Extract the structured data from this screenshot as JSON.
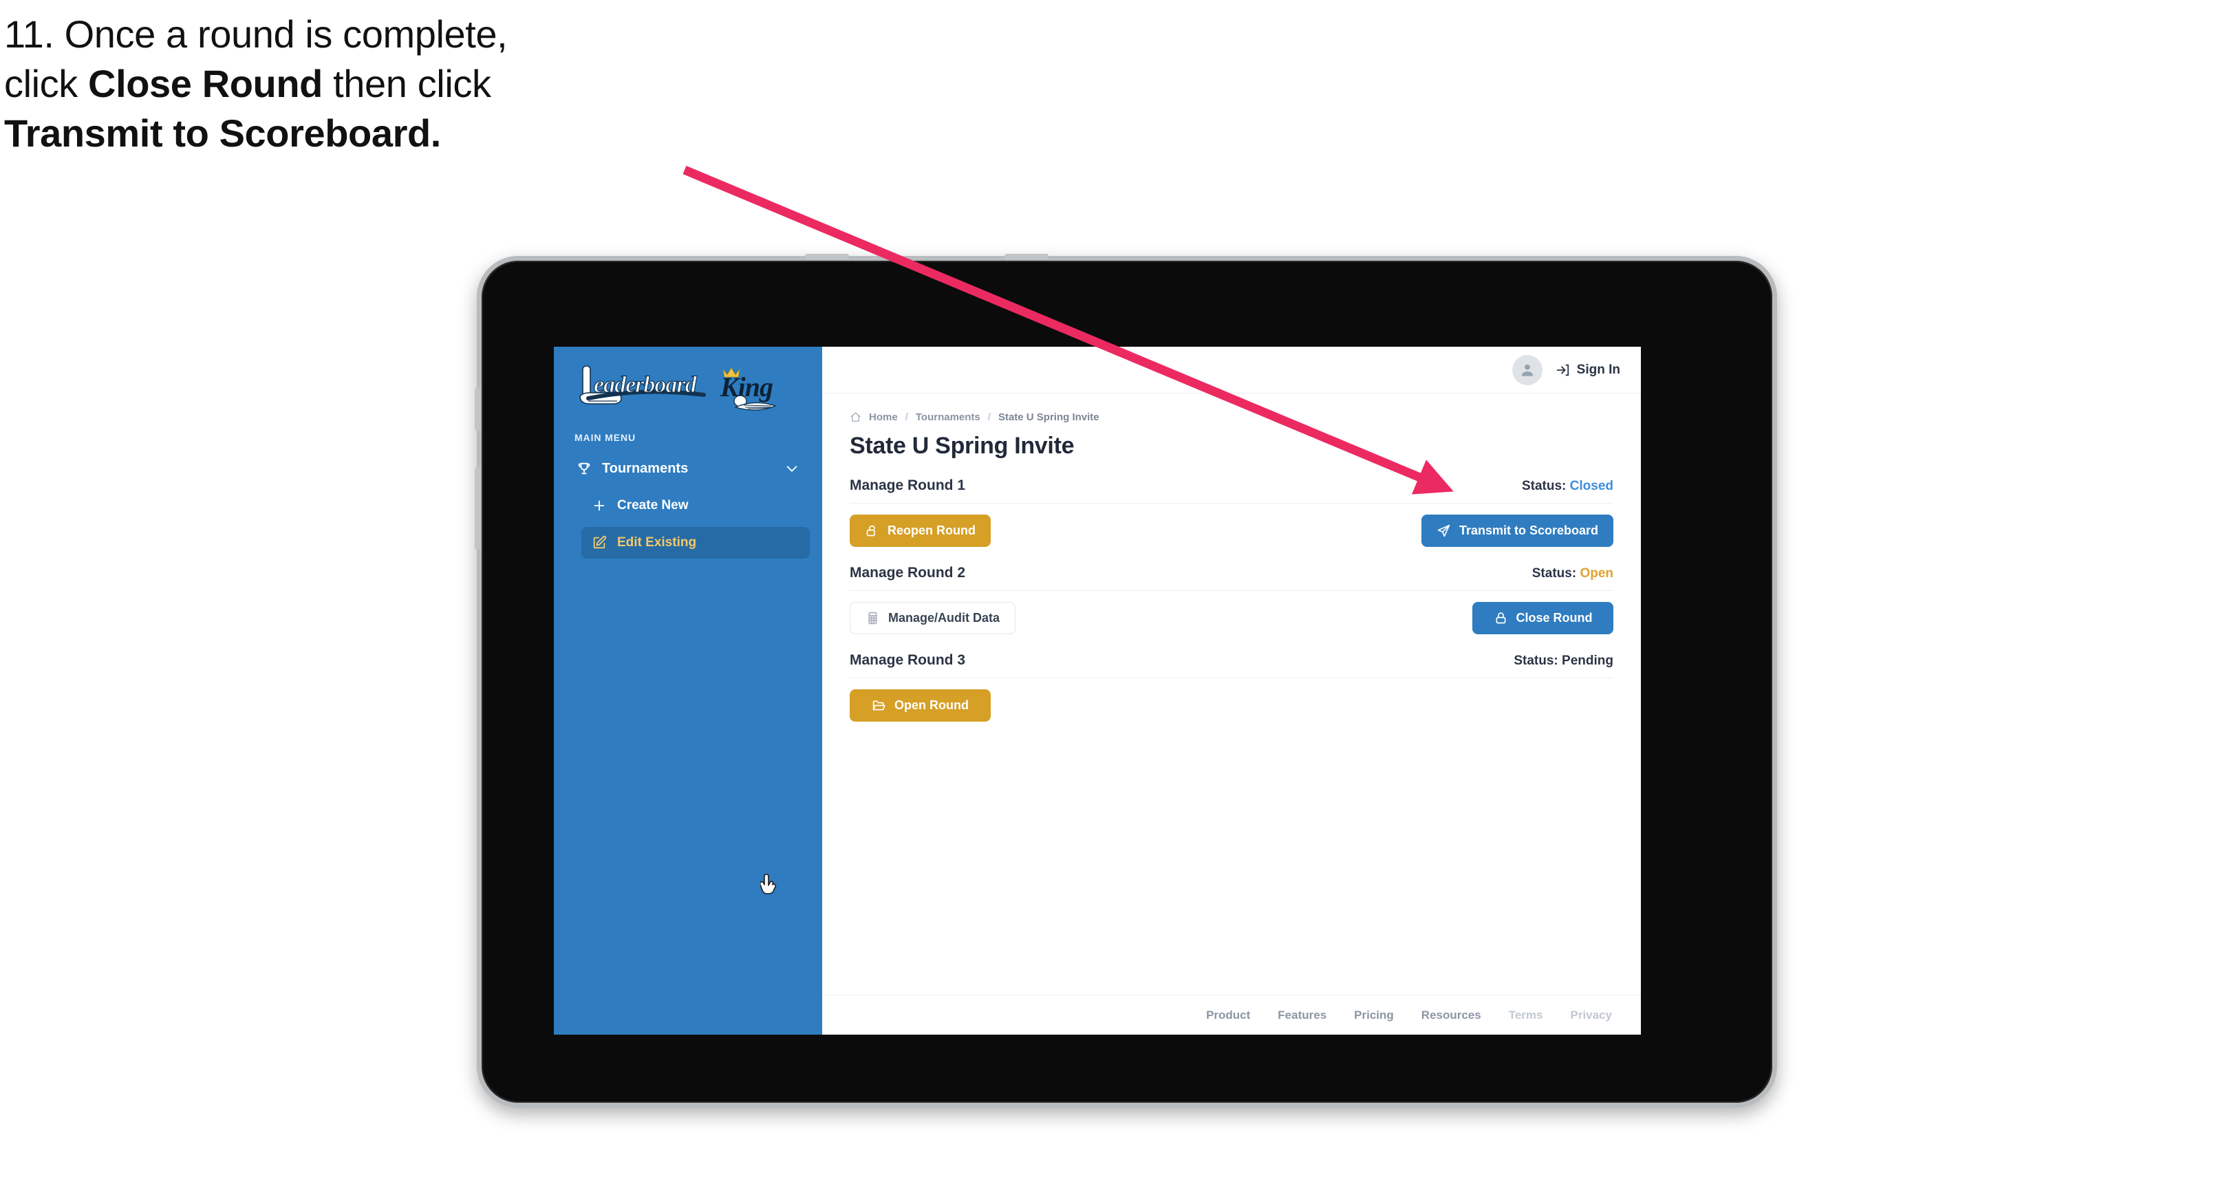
{
  "annotation": {
    "step_number": "11.",
    "lines": [
      {
        "parts": [
          {
            "t": "11. Once a round is complete,",
            "bold": false
          }
        ]
      },
      {
        "parts": [
          {
            "t": "click ",
            "bold": false
          },
          {
            "t": "Close Round",
            "bold": true
          },
          {
            "t": " then click",
            "bold": false
          }
        ]
      },
      {
        "parts": [
          {
            "t": "Transmit to Scoreboard.",
            "bold": true
          }
        ]
      }
    ],
    "line1": "11. Once a round is complete,",
    "line2_plain_a": "click ",
    "line2_bold": "Close Round",
    "line2_plain_b": " then click",
    "line3_bold": "Transmit to Scoreboard.",
    "arrow_color": "#ec2a62"
  },
  "app": {
    "logo_primary": "Leaderboard",
    "logo_secondary": "King",
    "sidebar": {
      "section_label": "MAIN MENU",
      "items": [
        {
          "label": "Tournaments",
          "icon": "trophy-icon",
          "expanded": true,
          "chevron": "chevron-down-icon"
        },
        {
          "label": "Create New",
          "icon": "plus-icon",
          "active": false
        },
        {
          "label": "Edit Existing",
          "icon": "edit-square-icon",
          "active": true
        }
      ]
    },
    "topbar": {
      "avatar_icon": "user-avatar-icon",
      "signin_label": "Sign In",
      "signin_icon": "sign-in-arrow-icon"
    },
    "breadcrumb": {
      "home_icon": "home-icon",
      "items": [
        "Home",
        "Tournaments",
        "State U Spring Invite"
      ],
      "separator": "/"
    },
    "page_title": "State U Spring Invite",
    "rounds": [
      {
        "name": "Manage Round 1",
        "status_label": "Status:",
        "status_value": "Closed",
        "status_kind": "closed",
        "left_button": {
          "label": "Reopen Round",
          "icon": "unlock-icon",
          "style": "gold"
        },
        "right_button": {
          "label": "Transmit to Scoreboard",
          "icon": "paper-plane-icon",
          "style": "blue"
        }
      },
      {
        "name": "Manage Round 2",
        "status_label": "Status:",
        "status_value": "Open",
        "status_kind": "open",
        "left_button": {
          "label": "Manage/Audit Data",
          "icon": "table-grid-icon",
          "style": "ghost"
        },
        "right_button": {
          "label": "Close Round",
          "icon": "lock-icon",
          "style": "blue"
        }
      },
      {
        "name": "Manage Round 3",
        "status_label": "Status:",
        "status_value": "Pending",
        "status_kind": "pending",
        "left_button": {
          "label": "Open Round",
          "icon": "folder-open-icon",
          "style": "gold"
        },
        "right_button": null
      }
    ],
    "footer_links": [
      {
        "label": "Product",
        "dim": false
      },
      {
        "label": "Features",
        "dim": false
      },
      {
        "label": "Pricing",
        "dim": false
      },
      {
        "label": "Resources",
        "dim": false
      },
      {
        "label": "Terms",
        "dim": true
      },
      {
        "label": "Privacy",
        "dim": true
      }
    ],
    "colors": {
      "sidebar_blue": "#2f7cc0",
      "accent_gold": "#d69f26",
      "button_blue": "#2f7cc0",
      "status_closed": "#3d8ddc",
      "status_open": "#e0a22e",
      "text_dark": "#2b3445"
    },
    "cursor": "hand-pointer-cursor"
  }
}
